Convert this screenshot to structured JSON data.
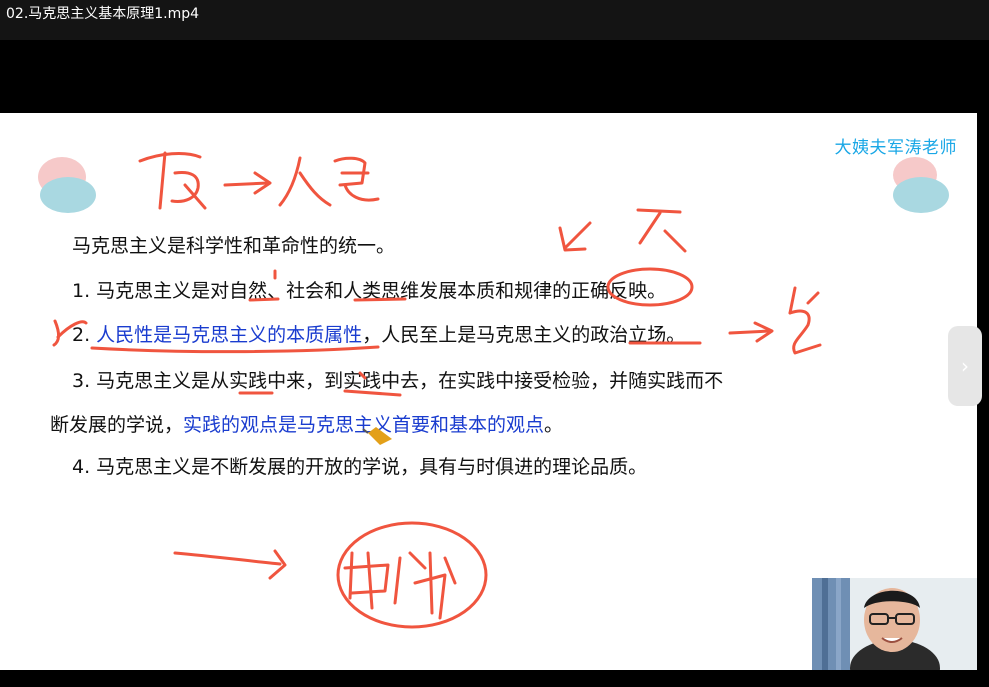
{
  "window": {
    "title": "02.马克思主义基本原理1.mp4"
  },
  "slide": {
    "watermark": "大姨夫军涛老师",
    "intro": "马克思主义是科学性和革命性的统一。",
    "item1": "1. 马克思主义是对自然、社会和人类思维发展本质和规律的正确反映。",
    "item2_num": "2. ",
    "item2_blue": "人民性是马克思主义的本质属性",
    "item2_rest": "，人民至上是马克思主义的政治立场。",
    "item3_a": "3.  马克思主义是从实践中来，到实践中去，在实践中接受检验，并随实践而不",
    "item3_b_pre": "断发展的学说，",
    "item3_b_blue": "实践的观点是马克思主义首要和基本的观点",
    "item3_b_post": "。",
    "item4": "4. 马克思主义是不断发展的开放的学说，具有与时俱进的理论品质。"
  },
  "controls": {
    "next_icon": "chevron-right-icon"
  },
  "colors": {
    "ink": "#f0553f",
    "watermark": "#19a7e6",
    "blue_text": "#1a3ccf"
  }
}
